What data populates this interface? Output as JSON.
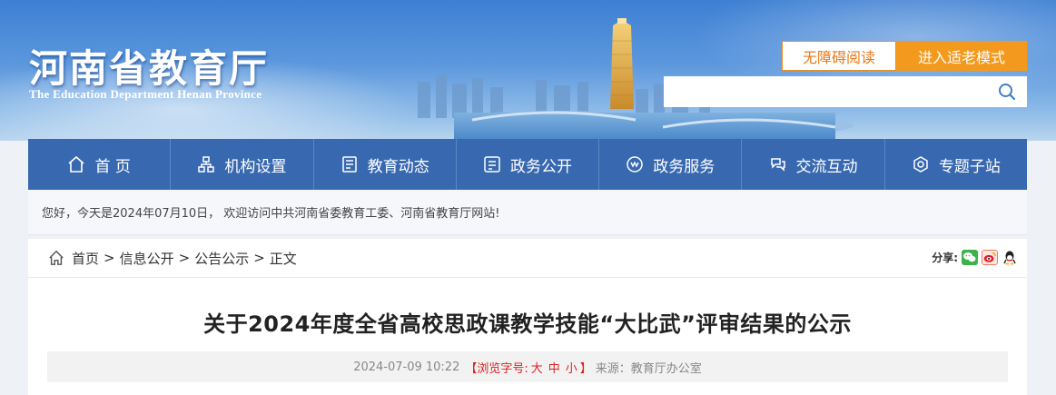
{
  "header": {
    "site_title": "河南省教育厅",
    "site_subtitle": "The Education Department Henan Province",
    "accessibility_label": "无障碍阅读",
    "elder_mode_label": "进入适老模式",
    "search_placeholder": ""
  },
  "nav": {
    "items": [
      {
        "label": "首 页",
        "icon": "home-icon"
      },
      {
        "label": "机构设置",
        "icon": "org-icon"
      },
      {
        "label": "教育动态",
        "icon": "news-icon"
      },
      {
        "label": "政务公开",
        "icon": "public-icon"
      },
      {
        "label": "政务服务",
        "icon": "service-icon"
      },
      {
        "label": "交流互动",
        "icon": "interact-icon"
      },
      {
        "label": "专题子站",
        "icon": "subsite-icon"
      }
    ]
  },
  "welcome": {
    "text": "您好，今天是2024年07月10日， 欢迎访问中共河南省委教育工委、河南省教育厅网站!"
  },
  "breadcrumb": {
    "items": [
      "首页",
      "信息公开",
      "公告公示"
    ],
    "current": "正文",
    "separator": ">"
  },
  "share": {
    "label": "分享:",
    "icons": [
      "wechat-icon",
      "weibo-icon",
      "qq-icon"
    ]
  },
  "article": {
    "title": "关于2024年度全省高校思政课教学技能“大比武”评审结果的公示",
    "date": "2024-07-09 10:22",
    "font_size_label": "【浏览字号:",
    "font_size_large": "大",
    "font_size_medium": "中",
    "font_size_small": "小",
    "font_size_close": "】",
    "source": "来源：教育厅办公室"
  },
  "colors": {
    "nav_bg": "#3869b0",
    "accent_orange": "#f39a1e",
    "red": "#dd2222"
  }
}
